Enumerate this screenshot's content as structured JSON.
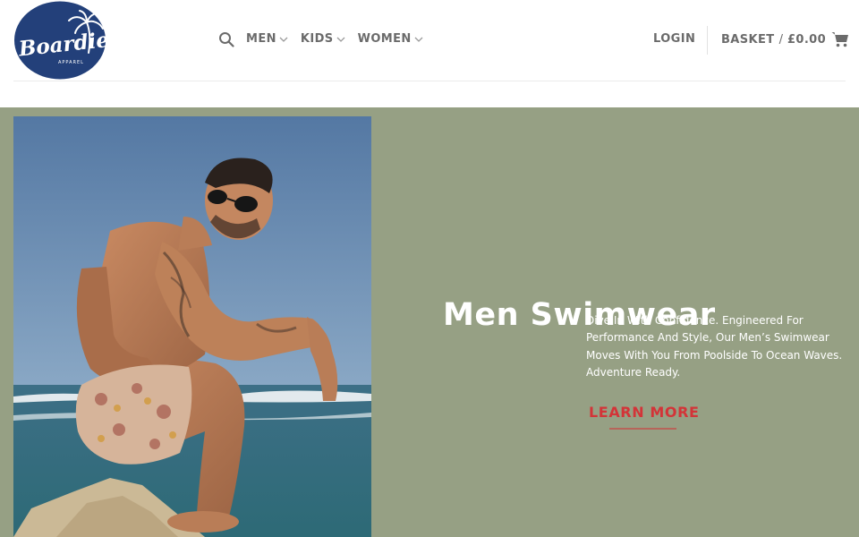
{
  "brand": {
    "name": "Boardies",
    "subtitle": "APPAREL",
    "navy": "#23407a"
  },
  "header": {
    "search": {
      "icon": "search-icon"
    },
    "nav": [
      {
        "label": "MEN",
        "icon": "chevron-down-icon"
      },
      {
        "label": "KIDS",
        "icon": "chevron-down-icon"
      },
      {
        "label": "WOMEN",
        "icon": "chevron-down-icon"
      }
    ],
    "login_label": "LOGIN",
    "basket": {
      "label": "BASKET",
      "separator": "/",
      "total": "£0.00",
      "icon": "cart-icon"
    }
  },
  "hero": {
    "title": "Men Swimwear",
    "description": "Dive In With Confidence. Engineered For Performance And Style, Our Men’s Swimwear Moves With You From Poolside To Ocean Waves. Adventure Ready.",
    "cta_label": "LEARN MORE",
    "background_color": "#96a084",
    "cta_color": "#d33438"
  }
}
